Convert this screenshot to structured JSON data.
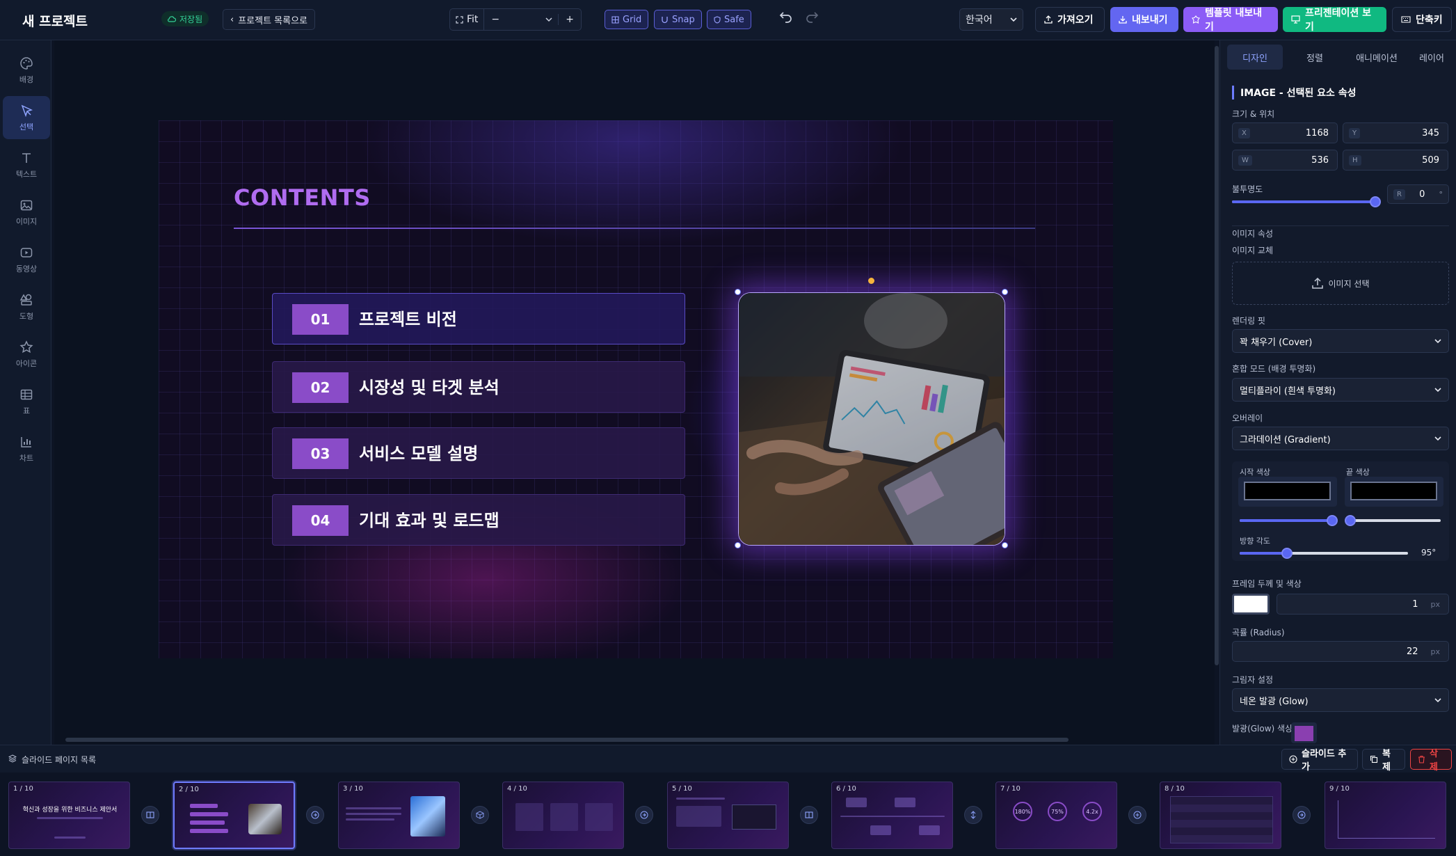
{
  "header": {
    "project_title": "새 프로젝트",
    "saved_badge": "저장됨",
    "back_button": "프로젝트 목록으로",
    "zoom_label": "Fit",
    "zoom_minus": "−",
    "zoom_plus": "+",
    "toggles": {
      "grid": "Grid",
      "snap": "Snap",
      "safe": "Safe"
    },
    "language": "한국어",
    "import_button": "가져오기",
    "export_button": "내보내기",
    "template_export_button": "템플릿 내보내기",
    "presentation_button": "프리젠테이션 보기",
    "shortcuts_button": "단축키"
  },
  "sidebar": {
    "items": [
      {
        "label": "배경",
        "icon": "palette-icon"
      },
      {
        "label": "선택",
        "icon": "pointer-icon"
      },
      {
        "label": "텍스트",
        "icon": "text-icon"
      },
      {
        "label": "이미지",
        "icon": "image-icon"
      },
      {
        "label": "동영상",
        "icon": "video-icon"
      },
      {
        "label": "도형",
        "icon": "shapes-icon"
      },
      {
        "label": "아이콘",
        "icon": "star-icon"
      },
      {
        "label": "표",
        "icon": "table-icon"
      },
      {
        "label": "차트",
        "icon": "chart-icon"
      }
    ]
  },
  "slide": {
    "title": "CONTENTS",
    "items": [
      {
        "num": "01",
        "label": "프로젝트 비전"
      },
      {
        "num": "02",
        "label": "시장성 및 타겟 분석"
      },
      {
        "num": "03",
        "label": "서비스 모델 설명"
      },
      {
        "num": "04",
        "label": "기대 효과 및 로드맵"
      }
    ]
  },
  "panel": {
    "tabs": [
      "디자인",
      "정렬",
      "애니메이션",
      "레이어"
    ],
    "section_title": "IMAGE - 선택된 요소 속성",
    "size_position_label": "크기 & 위치",
    "x_tag": "X",
    "x": "1168",
    "y_tag": "Y",
    "y": "345",
    "w_tag": "W",
    "w": "536",
    "h_tag": "H",
    "h": "509",
    "opacity_label": "불투명도",
    "rotation_tag": "R",
    "rotation": "0",
    "rotation_unit": "°",
    "image_props_label": "이미지 속성",
    "image_replace_label": "이미지 교체",
    "image_select": "이미지 선택",
    "rendering_fit_label": "렌더링 핏",
    "rendering_fit": "꽉 채우기 (Cover)",
    "blend_mode_label": "혼합 모드 (배경 투명화)",
    "blend_mode": "멀티플라이 (흰색 투명화)",
    "overlay_label": "오버레이",
    "overlay": "그라데이션 (Gradient)",
    "start_color_label": "시작 색상",
    "end_color_label": "끝 색상",
    "direction_label": "방향 각도",
    "direction_value": "95°",
    "frame_label": "프레임 두께 및 색상",
    "frame_value": "1",
    "px": "px",
    "radius_label": "곡률 (Radius)",
    "radius_value": "22",
    "shadow_label": "그림자 설정",
    "shadow": "네온 발광 (Glow)",
    "glow_color_label": "발광(Glow) 색상",
    "glow_color": "#8a3fb0"
  },
  "slides_bar": {
    "title": "슬라이드 페이지 목록",
    "add_button": "슬라이드 추가",
    "duplicate_button": "복제",
    "delete_button": "삭제",
    "thumbnails": [
      {
        "label": "1 / 10",
        "caption": "혁신과 성장을 위한 비즈니스 제안서"
      },
      {
        "label": "2 / 10"
      },
      {
        "label": "3 / 10"
      },
      {
        "label": "4 / 10"
      },
      {
        "label": "5 / 10"
      },
      {
        "label": "6 / 10"
      },
      {
        "label": "7 / 10"
      },
      {
        "label": "8 / 10"
      },
      {
        "label": "9 / 10"
      }
    ],
    "thumb7_values": [
      "180%",
      "75%",
      "4.2x"
    ]
  },
  "colors": {
    "accent": "#5a67f2",
    "slide_title": "#b06cf0",
    "number_badge": "#8a4cc8",
    "presentation_green": "#10b981",
    "export_purple": "#6366f1",
    "template_purple": "#8b5cf6",
    "delete_red": "#ef4444"
  }
}
